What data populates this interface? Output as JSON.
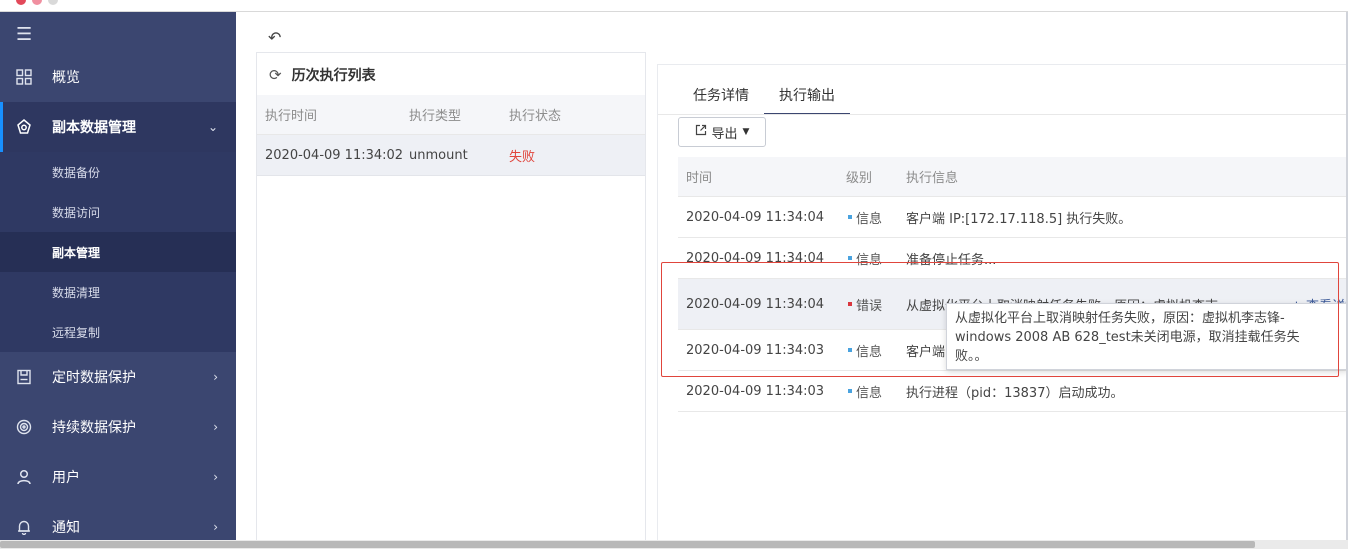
{
  "colors": {
    "sidebar_bg": "#3b4670",
    "sidebar_active": "#2e3760",
    "accent": "#1890ff",
    "status_fail": "#e0453c",
    "level_info": "#4aa3df",
    "level_error": "#d9363e"
  },
  "sidebar": {
    "toggle_icon": "hamburger-icon",
    "items": [
      {
        "label": "概览",
        "icon": "grid-icon"
      },
      {
        "label": "副本数据管理",
        "icon": "copy-data-icon",
        "expanded": true
      },
      {
        "label": "定时数据保护",
        "icon": "schedule-save-icon"
      },
      {
        "label": "持续数据保护",
        "icon": "continuous-protect-icon"
      },
      {
        "label": "用户",
        "icon": "user-icon"
      },
      {
        "label": "通知",
        "icon": "bell-icon"
      }
    ],
    "subitems": [
      {
        "label": "数据备份"
      },
      {
        "label": "数据访问"
      },
      {
        "label": "副本管理",
        "active": true
      },
      {
        "label": "数据清理"
      },
      {
        "label": "远程复制"
      }
    ]
  },
  "history": {
    "title": "历次执行列表",
    "columns": [
      "执行时间",
      "执行类型",
      "执行状态"
    ],
    "rows": [
      {
        "time": "2020-04-09 11:34:02",
        "type": "unmount",
        "status": "失败"
      }
    ]
  },
  "detail": {
    "tabs": [
      "任务详情",
      "执行输出"
    ],
    "active_tab": 1,
    "export_label": "导出",
    "columns": [
      "时间",
      "级别",
      "执行信息"
    ],
    "rows": [
      {
        "time": "2020-04-09 11:34:04",
        "level": "信息",
        "message": "客户端 IP:[172.17.118.5] 执行失败。"
      },
      {
        "time": "2020-04-09 11:34:04",
        "level": "信息",
        "message": "准备停止任务..."
      },
      {
        "time": "2020-04-09 11:34:04",
        "level": "错误",
        "message": "从虚拟化平台上取消映射任务失败，原因：虚拟机李志…",
        "link": "+ 查看详情"
      },
      {
        "time": "2020-04-09 11:34:03",
        "level": "信息",
        "message": "客户端"
      },
      {
        "time": "2020-04-09 11:34:03",
        "level": "信息",
        "message": "执行进程（pid：13837）启动成功。"
      }
    ],
    "tooltip_lines": [
      "从虚拟化平台上取消映射任务失败，原因：虚拟机李志锋-",
      "windows 2008 AB 628_test未关闭电源，取消挂载任务失",
      "败。。"
    ]
  }
}
